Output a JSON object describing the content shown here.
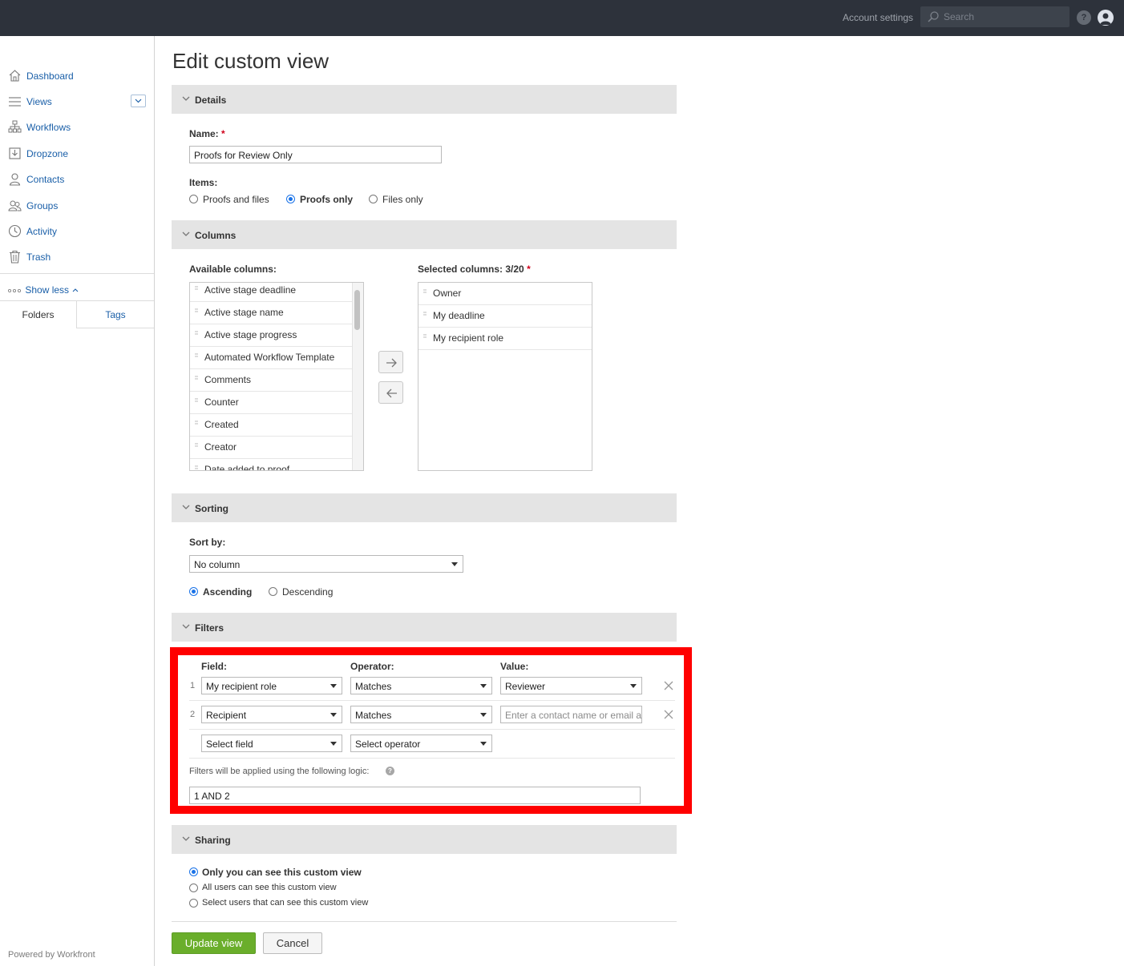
{
  "topbar": {
    "account_settings": "Account settings",
    "search_placeholder": "Search",
    "help": "?"
  },
  "sidebar": {
    "items": [
      {
        "label": "Dashboard",
        "icon": "home-icon"
      },
      {
        "label": "Views",
        "icon": "list-icon"
      },
      {
        "label": "Workflows",
        "icon": "workflow-icon"
      },
      {
        "label": "Dropzone",
        "icon": "dropzone-icon"
      },
      {
        "label": "Contacts",
        "icon": "contact-icon"
      },
      {
        "label": "Groups",
        "icon": "groups-icon"
      },
      {
        "label": "Activity",
        "icon": "clock-icon"
      },
      {
        "label": "Trash",
        "icon": "trash-icon"
      }
    ],
    "show_less": "Show less",
    "tabs": {
      "folders": "Folders",
      "tags": "Tags"
    },
    "powered_by": "Powered by Workfront"
  },
  "page": {
    "title": "Edit custom view"
  },
  "details": {
    "header": "Details",
    "name_label": "Name:",
    "required_mark": "*",
    "name_value": "Proofs for Review Only",
    "items_label": "Items:",
    "items_options": [
      {
        "label": "Proofs and files",
        "selected": false
      },
      {
        "label": "Proofs only",
        "selected": true
      },
      {
        "label": "Files only",
        "selected": false
      }
    ]
  },
  "columns": {
    "header": "Columns",
    "available_label": "Available columns:",
    "selected_label": "Selected columns: 3/20",
    "required_mark": "*",
    "available": [
      "Active stage deadline",
      "Active stage name",
      "Active stage progress",
      "Automated Workflow Template",
      "Comments",
      "Counter",
      "Created",
      "Creator",
      "Date added to proof"
    ],
    "selected": [
      "Owner",
      "My deadline",
      "My recipient role"
    ]
  },
  "sorting": {
    "header": "Sorting",
    "sort_by_label": "Sort by:",
    "sort_by_value": "No column",
    "orders": [
      {
        "label": "Ascending",
        "selected": true
      },
      {
        "label": "Descending",
        "selected": false
      }
    ]
  },
  "filters": {
    "header": "Filters",
    "field_label": "Field:",
    "operator_label": "Operator:",
    "value_label": "Value:",
    "rows": [
      {
        "num": "1",
        "field": "My recipient role",
        "operator": "Matches",
        "value": "Reviewer"
      },
      {
        "num": "2",
        "field": "Recipient",
        "operator": "Matches",
        "value_placeholder": "Enter a contact name or email address"
      }
    ],
    "new_row": {
      "field": "Select field",
      "operator": "Select operator"
    },
    "logic_label": "Filters will be applied using the following logic:",
    "logic_value": "1 AND 2"
  },
  "sharing": {
    "header": "Sharing",
    "options": [
      {
        "label": "Only you can see this custom view",
        "selected": true
      },
      {
        "label": "All users can see this custom view",
        "selected": false
      },
      {
        "label": "Select users that can see this custom view",
        "selected": false
      }
    ]
  },
  "actions": {
    "update": "Update view",
    "cancel": "Cancel"
  },
  "colors": {
    "accent": "#1a5fa8",
    "primary_button": "#6aae2b",
    "highlight": "#ff0000",
    "topbar": "#2d323b"
  }
}
